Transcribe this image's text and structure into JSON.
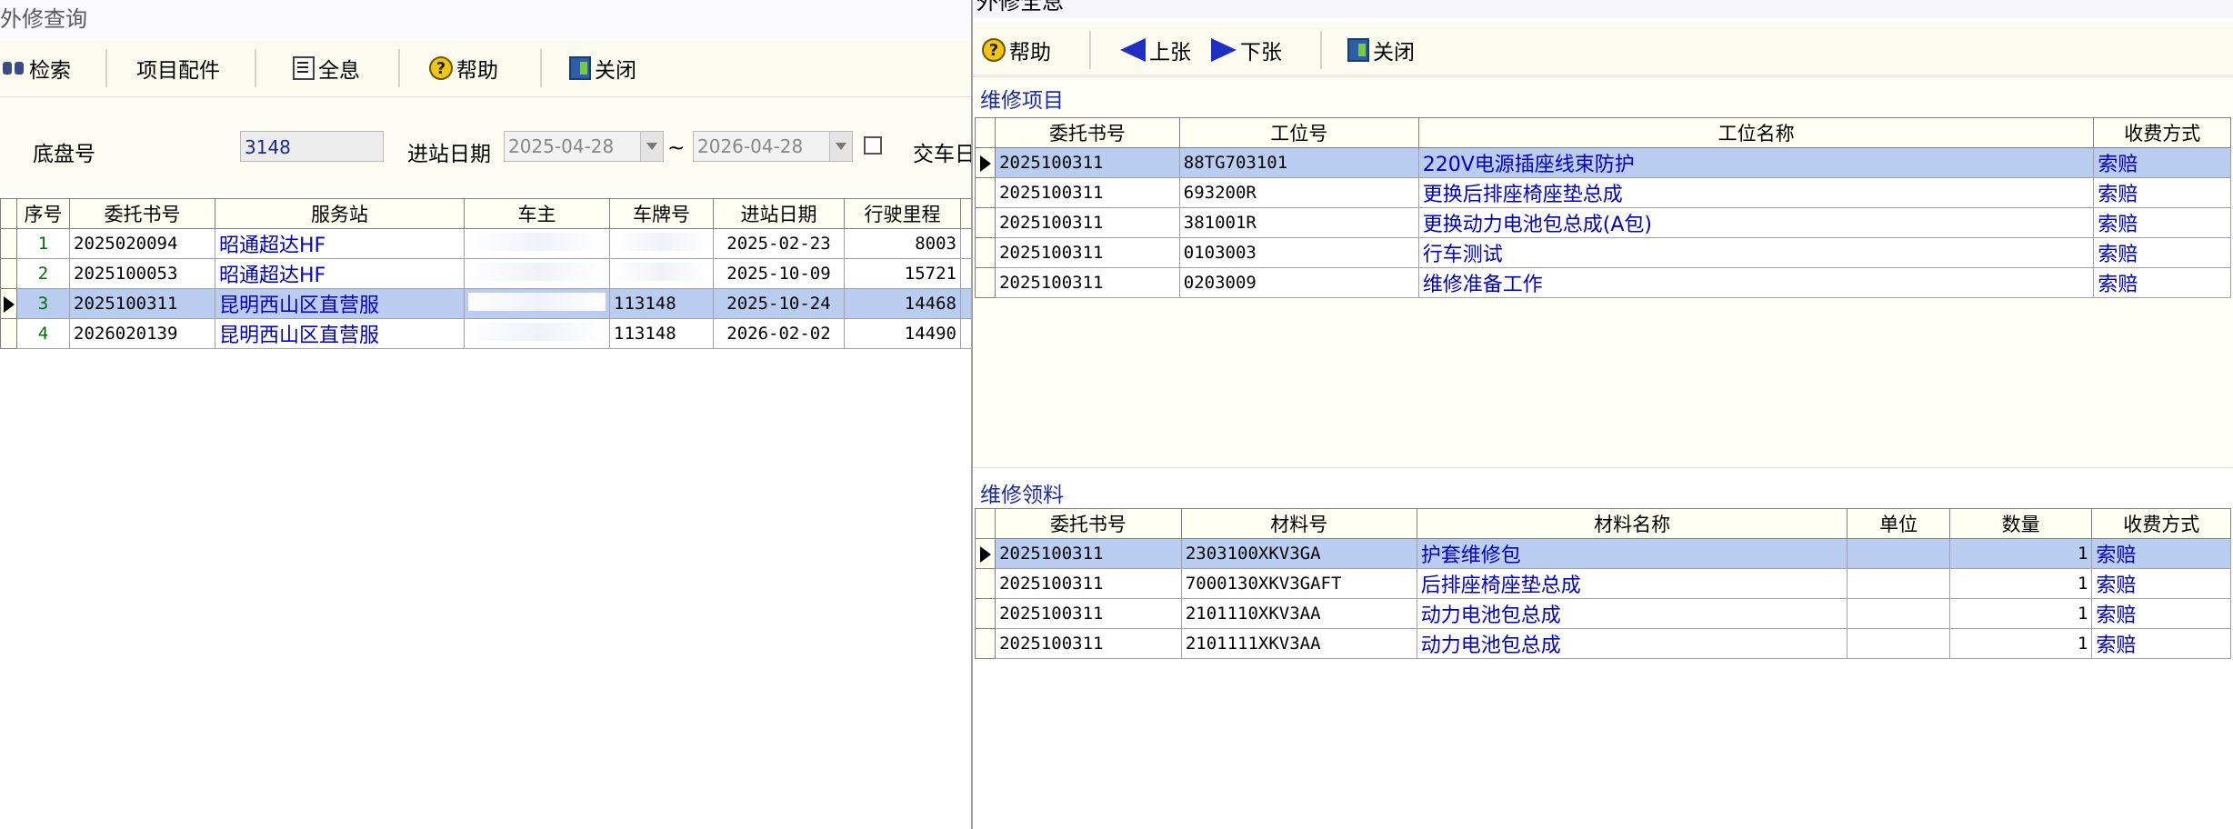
{
  "left": {
    "title": "外修查询",
    "toolbar": {
      "search": "检索",
      "parts": "项目配件",
      "full": "全息",
      "help": "帮助",
      "close": "关闭"
    },
    "filter": {
      "chassis_label": "底盘号",
      "chassis_value": "3148",
      "date_label": "进站日期",
      "date_from": "2025-04-28",
      "tilde": "~",
      "date_to": "2026-04-28",
      "delivery_label": "交车日"
    },
    "table": {
      "headers": [
        "序号",
        "委托书号",
        "服务站",
        "车主",
        "车牌号",
        "进站日期",
        "行驶里程"
      ],
      "rows": [
        {
          "no": "1",
          "order": "2025020094",
          "station": "昭通超达HF",
          "owner": "",
          "plate": "",
          "date": "2025-02-23",
          "mileage": "8003"
        },
        {
          "no": "2",
          "order": "2025100053",
          "station": "昭通超达HF",
          "owner": "",
          "plate": "",
          "date": "2025-10-09",
          "mileage": "15721"
        },
        {
          "no": "3",
          "order": "2025100311",
          "station": "昆明西山区直营服",
          "owner": "",
          "plate": "113148",
          "date": "2025-10-24",
          "mileage": "14468"
        },
        {
          "no": "4",
          "order": "2026020139",
          "station": "昆明西山区直营服",
          "owner": "",
          "plate": "113148",
          "date": "2026-02-02",
          "mileage": "14490"
        }
      ]
    }
  },
  "right": {
    "title": "外修全息",
    "toolbar": {
      "help": "帮助",
      "prev": "上张",
      "next": "下张",
      "close": "关闭"
    },
    "items": {
      "section": "维修项目",
      "headers": [
        "委托书号",
        "工位号",
        "工位名称",
        "收费方式"
      ],
      "rows": [
        {
          "order": "2025100311",
          "code": "88TG703101",
          "name": "220V电源插座线束防护",
          "fee": "索赔"
        },
        {
          "order": "2025100311",
          "code": "693200R",
          "name": "更换后排座椅座垫总成",
          "fee": "索赔"
        },
        {
          "order": "2025100311",
          "code": "381001R",
          "name": "更换动力电池包总成(A包)",
          "fee": "索赔"
        },
        {
          "order": "2025100311",
          "code": "0103003",
          "name": "行车测试",
          "fee": "索赔"
        },
        {
          "order": "2025100311",
          "code": "0203009",
          "name": "维修准备工作",
          "fee": "索赔"
        }
      ]
    },
    "materials": {
      "section": "维修领料",
      "headers": [
        "委托书号",
        "材料号",
        "材料名称",
        "单位",
        "数量",
        "收费方式"
      ],
      "rows": [
        {
          "order": "2025100311",
          "code": "2303100XKV3GA",
          "name": "护套维修包",
          "unit": "",
          "qty": "1",
          "fee": "索赔"
        },
        {
          "order": "2025100311",
          "code": "7000130XKV3GAFT",
          "name": "后排座椅座垫总成",
          "unit": "",
          "qty": "1",
          "fee": "索赔"
        },
        {
          "order": "2025100311",
          "code": "2101110XKV3AA",
          "name": "动力电池包总成",
          "unit": "",
          "qty": "1",
          "fee": "索赔"
        },
        {
          "order": "2025100311",
          "code": "2101111XKV3AA",
          "name": "动力电池包总成",
          "unit": "",
          "qty": "1",
          "fee": "索赔"
        }
      ]
    }
  },
  "colors": {
    "selected_row": "#b8cdf0",
    "toolbar_bg": "#fbfbf0",
    "link_blue": "#0000c0"
  }
}
